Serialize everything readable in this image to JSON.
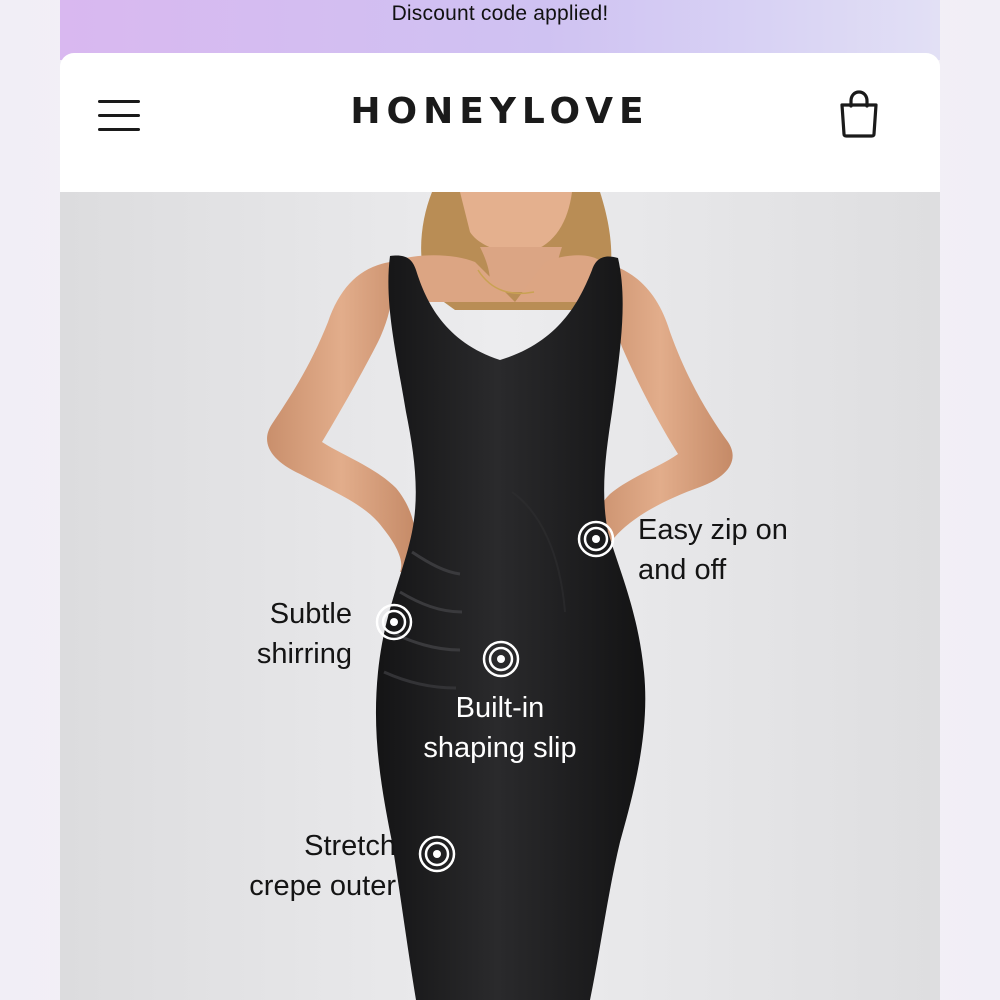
{
  "promo": {
    "text": "Discount code applied!"
  },
  "header": {
    "brand": "HONEYLOVE",
    "menu_icon": "hamburger-menu-icon",
    "cart_icon": "shopping-bag-icon"
  },
  "hero": {
    "product_color": "#1c1c1e",
    "background_color": "#e6e6e8",
    "features": [
      {
        "line1": "Easy zip on",
        "line2": "and off"
      },
      {
        "line1": "Subtle",
        "line2": "shirring"
      },
      {
        "line1": "Built-in",
        "line2": "shaping slip"
      },
      {
        "line1": "Stretch",
        "line2": "crepe outer"
      }
    ],
    "hotspot_icon": "target-dot-icon"
  },
  "colors": {
    "promo_gradient_start": "#d9b8f0",
    "promo_gradient_end": "#e2e0f5",
    "text_dark": "#141414",
    "text_light": "#ffffff"
  }
}
